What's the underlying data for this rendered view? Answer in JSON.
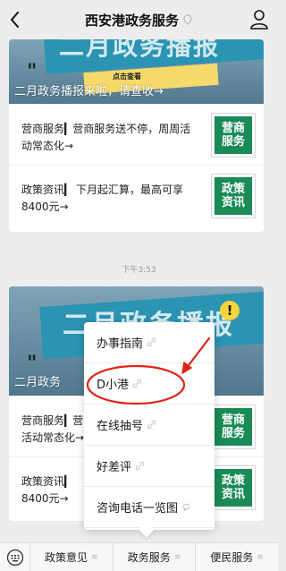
{
  "header": {
    "title": "西安港政务服务"
  },
  "card1": {
    "banner_big": "二月政务播报",
    "banner_pill": "点击查看",
    "banner_title": "二月政务播报来啦，请查收→",
    "rows": [
      {
        "text": "营商服务▎营商服务送不停，周周活动常态化→",
        "thumb": "营商服务"
      },
      {
        "text": "政策资讯▎ 下月起汇算，最高可享8400元→",
        "thumb": "政策资讯"
      }
    ]
  },
  "timestamp": "下午3:53",
  "card2": {
    "banner_big": "二月政务播报",
    "banner_title": "二月政务",
    "exclaim": "!",
    "rows": [
      {
        "text": "营商服务▎营",
        "text2": "活动常态化→",
        "thumb": "营商服务"
      },
      {
        "text": "政策资讯▎",
        "text2": "8400元→",
        "thumb": "政策资讯"
      }
    ]
  },
  "popup_menu": {
    "items": [
      {
        "label": "办事指南",
        "icon": "link-icon"
      },
      {
        "label": "D小港",
        "icon": "link-icon"
      },
      {
        "label": "在线抽号",
        "icon": "link-icon"
      },
      {
        "label": "好差评",
        "icon": "link-icon"
      },
      {
        "label": "咨询电话一览图",
        "icon": "chat-icon"
      }
    ]
  },
  "bottom_menu": {
    "tabs": [
      {
        "label": "政策意见"
      },
      {
        "label": "政务服务"
      },
      {
        "label": "便民服务"
      }
    ]
  },
  "colors": {
    "accent_red": "#e0241b",
    "thumb_green": "#1a8a56",
    "banner_yellow": "#f5d96b"
  }
}
